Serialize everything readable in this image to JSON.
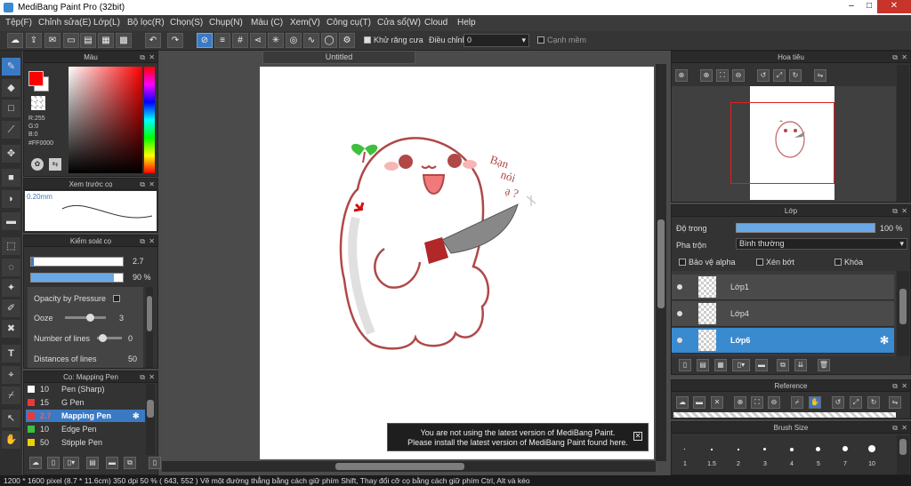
{
  "window": {
    "title": "MediBang Paint Pro (32bit)",
    "buttons": [
      "–",
      "□",
      "✕"
    ]
  },
  "menu": [
    "Tệp(F)",
    "Chỉnh sửa(E)",
    "Lớp(L)",
    "Bộ lọc(R)",
    "Chọn(S)",
    "Chụp(N)",
    "Màu (C)",
    "Xem(V)",
    "Công cụ(T)",
    "Cửa sổ(W)",
    "Cloud",
    "Help"
  ],
  "toolbar": {
    "antialias_label": "Khử răng cưa",
    "correction_label": "Điều chỉnh",
    "correction_value": "0",
    "edge_label": "Cạnh mềm"
  },
  "color_panel": {
    "title": "Màu",
    "r": "R:255",
    "g": "G:0",
    "b": "B:0",
    "hex": "#FF0000",
    "primary": "#ff0000",
    "secondary": "#ffffff"
  },
  "brush_preview": {
    "title": "Xem trước cọ",
    "size": "0.20mm"
  },
  "brush_control": {
    "title": "Kiểm soát cọ",
    "size": "2.7",
    "opacity": "90 %",
    "opacity_fraction": 0.9,
    "opacity_pressure": "Opacity by Pressure",
    "ooze": "Ooze",
    "ooze_value": "3",
    "lines": "Number of lines",
    "lines_value": "0",
    "distances": "Distances of lines",
    "distances_value": "50"
  },
  "brush_list": {
    "title": "Cọ: Mapping Pen",
    "items": [
      {
        "size": "10",
        "name": "Pen (Sharp)",
        "color": "#ffffff"
      },
      {
        "size": "15",
        "name": "G Pen",
        "color": "#e83a3a"
      },
      {
        "size": "2.7",
        "name": "Mapping Pen",
        "color": "#e83a3a"
      },
      {
        "size": "10",
        "name": "Edge Pen",
        "color": "#3fbf3f"
      },
      {
        "size": "50",
        "name": "Stipple Pen",
        "color": "#f0d000"
      }
    ]
  },
  "canvas": {
    "tab": "Untitled",
    "speech": [
      "Bạn",
      "nói",
      "ạ ?"
    ]
  },
  "notice": {
    "line1": "You are not using the latest version of MediBang Paint.",
    "line2": "Please install the latest version of MediBang Paint found here."
  },
  "navigator": {
    "title": "Hoa tiêu"
  },
  "layer_panel": {
    "title": "Lớp",
    "opacity_label": "Độ trong",
    "opacity_value": "100 %",
    "opacity_fraction": 1.0,
    "blend_label": "Pha trộn",
    "blend_value": "Bình thường",
    "protect_alpha": "Bảo vệ alpha",
    "clipping": "Xén bớt",
    "lock": "Khóa",
    "layers": [
      "Lớp1",
      "Lớp4",
      "Lớp6"
    ]
  },
  "reference": {
    "title": "Reference"
  },
  "brush_size": {
    "title": "Brush Size",
    "sizes": [
      "1",
      "1.5",
      "2",
      "3",
      "4",
      "5",
      "7",
      "10"
    ]
  },
  "status": "1200 * 1600 pixel  (8.7 * 11.6cm)  350 dpi  50 %  ( 643, 552 )  Vẽ một đường thẳng bằng cách giữ phím Shift, Thay đổi cỡ cọ bằng cách giữ phím Ctrl, Alt và kéo"
}
